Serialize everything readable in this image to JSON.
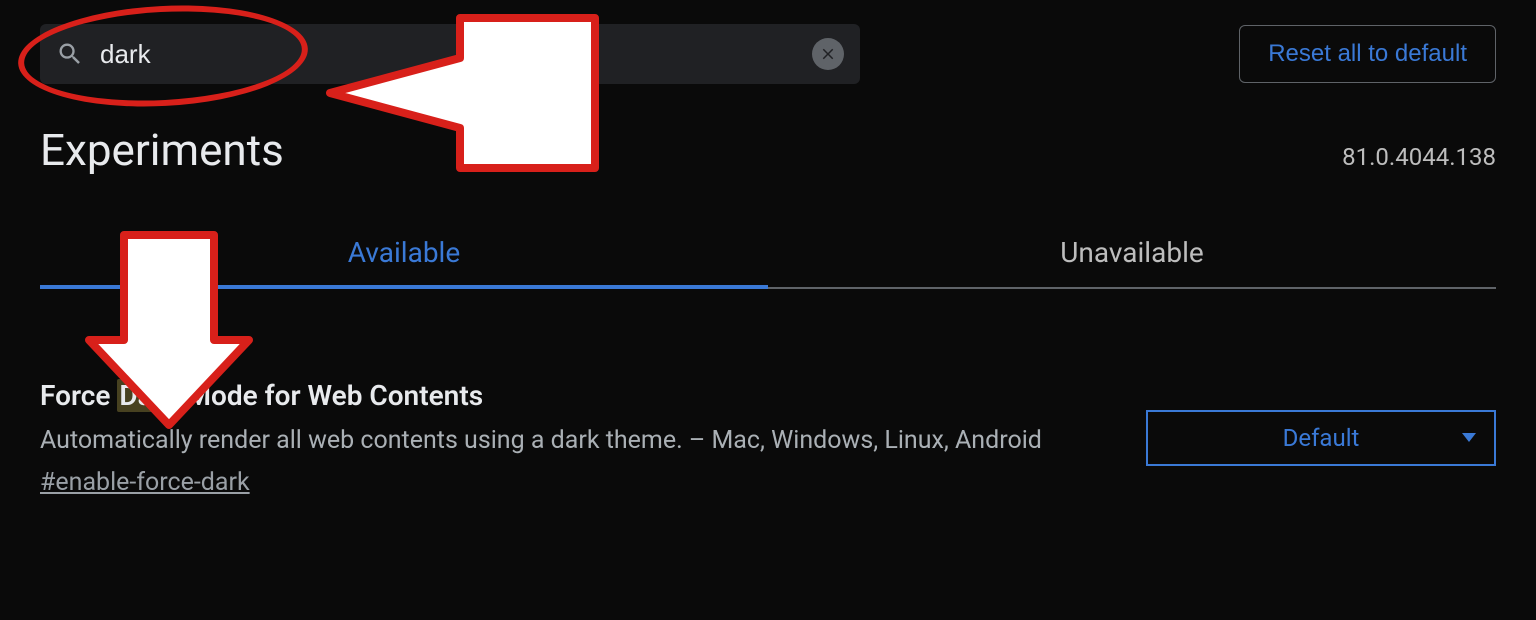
{
  "search": {
    "value": "dark"
  },
  "reset_label": "Reset all to default",
  "page_title": "Experiments",
  "version": "81.0.4044.138",
  "tabs": {
    "available": "Available",
    "unavailable": "Unavailable"
  },
  "experiment": {
    "title_pre": "Force ",
    "title_hl": "Dark",
    "title_post": " Mode for Web Contents",
    "desc": "Automatically render all web contents using a dark theme. – Mac, Windows, Linux, Android",
    "hash": "#enable-force-dark",
    "select_value": "Default"
  }
}
